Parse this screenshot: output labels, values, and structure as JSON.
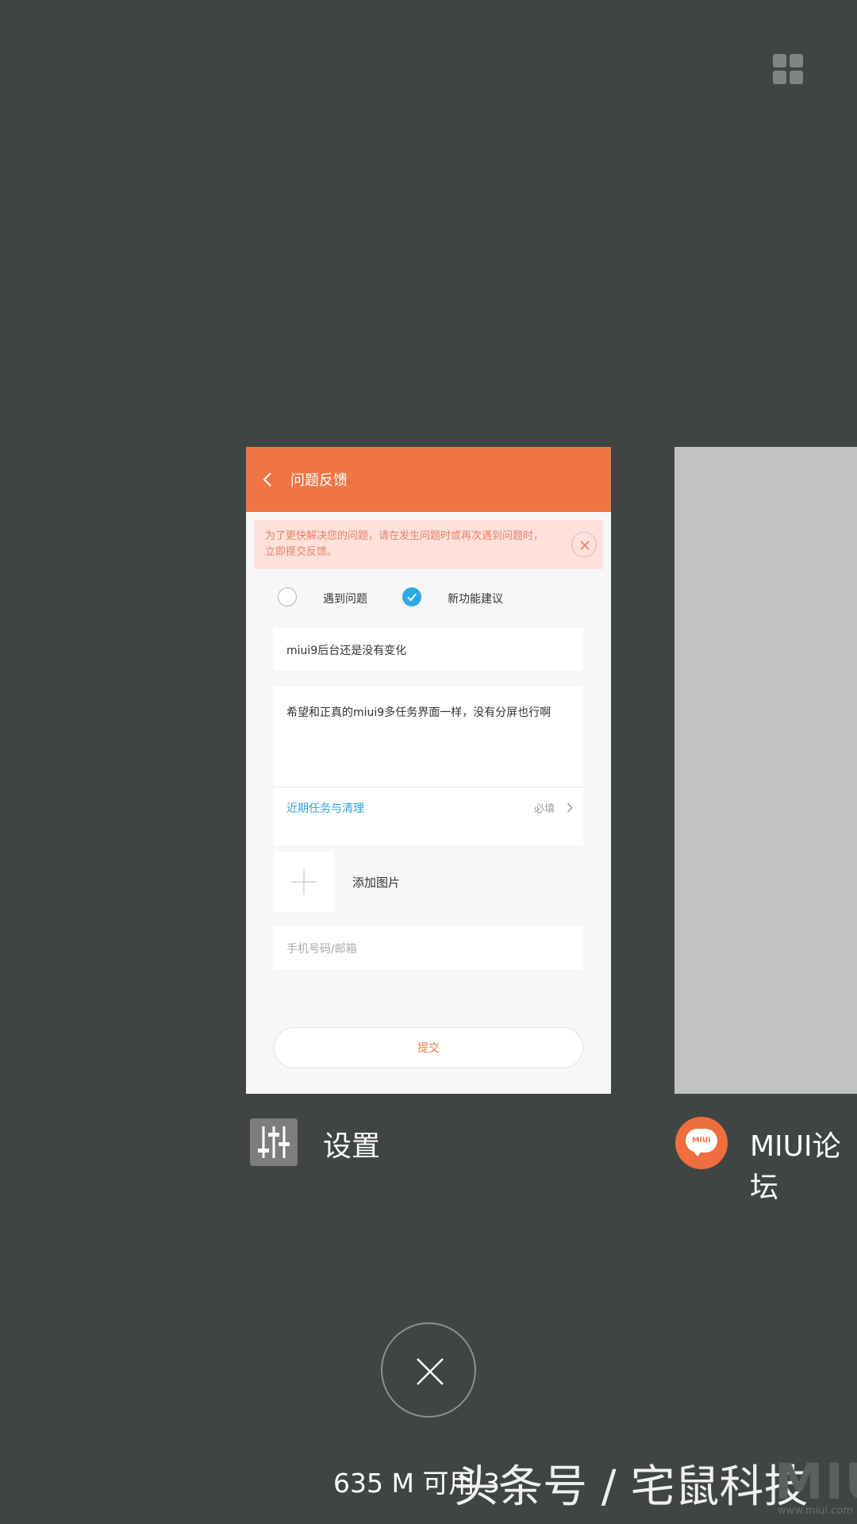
{
  "recents": {
    "grid_toggle_icon": "grid-view-icon",
    "cards": [
      {
        "app_name": "设置",
        "app_icon": "settings-sliders-icon",
        "screen": {
          "title": "问题反馈",
          "banner_text": "为了更快解决您的问题，请在发生问题时或再次遇到问题时，立即提交反馈。",
          "option_problem": "遇到问题",
          "option_suggestion": "新功能建议",
          "selected_option": "新功能建议",
          "subject_value": "miui9后台还是没有变化",
          "description_value": "希望和正真的miui9多任务界面一样，没有分屏也行啊",
          "category_value": "近期任务与清理",
          "required_label": "必填",
          "add_image_label": "添加图片",
          "contact_placeholder": "手机号码/邮箱",
          "submit_label": "提交"
        }
      },
      {
        "app_name": "MIUI论坛",
        "app_icon": "miui-forum-icon",
        "icon_text": "MIUI"
      }
    ],
    "clear_button_icon": "close-icon",
    "memory_text": "635 M 可用 3"
  },
  "overlay": {
    "watermark": "头条号 / 宅鼠科技",
    "miui_logo": "MIUI",
    "miui_url": "www.miui.com"
  },
  "colors": {
    "background": "#3f4543",
    "header": "#f07545",
    "accent_blue": "#2fa8e6"
  }
}
